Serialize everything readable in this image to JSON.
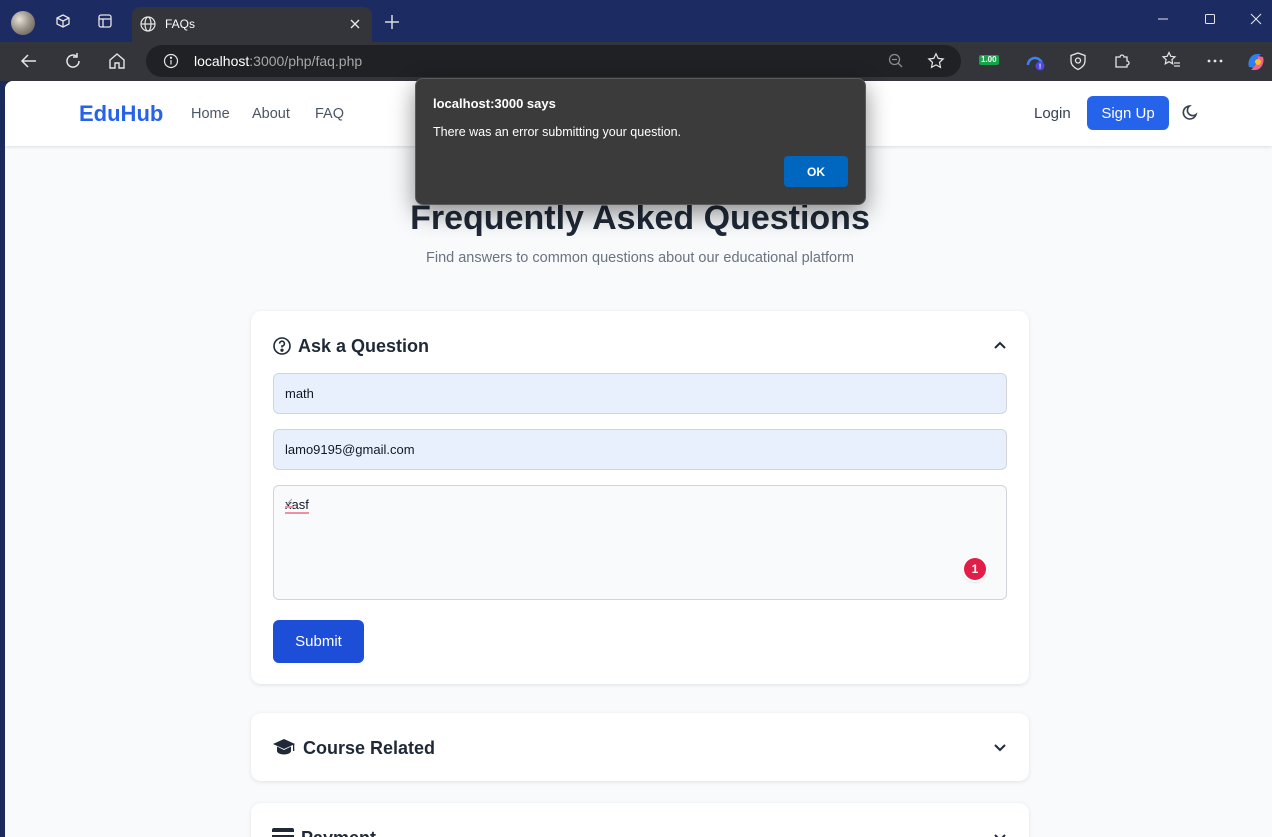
{
  "browser": {
    "tab_title": "FAQs",
    "url_host": "localhost",
    "url_rest": ":3000/php/faq.php",
    "ext_badge": "1.00"
  },
  "site": {
    "logo": "EduHub",
    "nav": [
      "Home",
      "About",
      "FAQ"
    ],
    "login": "Login",
    "signup": "Sign Up"
  },
  "hero": {
    "title": "Frequently Asked Questions",
    "subtitle": "Find answers to common questions about our educational platform"
  },
  "ask": {
    "title": "Ask a Question",
    "name_value": "math",
    "email_value": "lamo9195@gmail.com",
    "question_value": "xasf",
    "grammar_badge": "1",
    "submit": "Submit"
  },
  "sections": [
    {
      "title": "Course Related",
      "icon": "graduation-cap-icon"
    },
    {
      "title": "Payment",
      "icon": "credit-card-icon"
    }
  ],
  "dialog": {
    "title": "localhost:3000 says",
    "message": "There was an error submitting your question.",
    "ok": "OK"
  },
  "colors": {
    "brand": "#2563eb",
    "submit": "#1d4ed8",
    "dialog_ok": "#0067c0"
  }
}
